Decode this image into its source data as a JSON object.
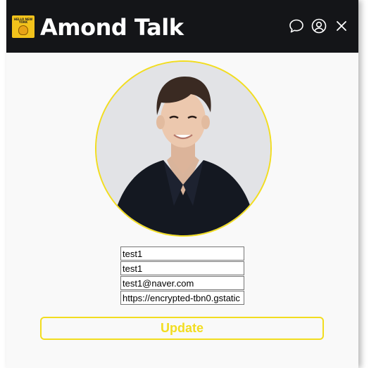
{
  "header": {
    "title": "Amond Talk",
    "logo_text": "HELLO NEW YORK",
    "icons": [
      "chat-bubble-icon",
      "user-circle-icon",
      "close-icon"
    ]
  },
  "profile": {
    "name": "test1",
    "nickname": "test1",
    "email": "test1@naver.com",
    "image_url": "https://encrypted-tbn0.gstatic"
  },
  "actions": {
    "update_label": "Update"
  },
  "colors": {
    "header_bg": "#141518",
    "accent": "#f2dd1f",
    "window_bg": "#f9f9f9"
  }
}
